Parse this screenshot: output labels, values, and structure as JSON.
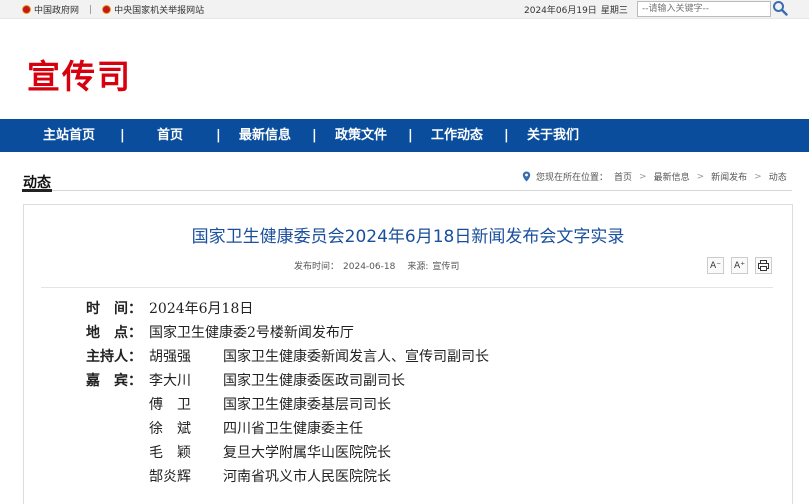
{
  "topbar": {
    "link1": "中国政府网",
    "separator": "|",
    "link2": "中央国家机关举报网站",
    "date": "2024年06月19日",
    "weekday": "星期三",
    "search_placeholder": "--请输入关键字--"
  },
  "header": {
    "site_title": "宣传司"
  },
  "nav": {
    "items": [
      "主站首页",
      "首页",
      "最新信息",
      "政策文件",
      "工作动态",
      "关于我们"
    ],
    "separator": "|"
  },
  "section": {
    "title": "动态"
  },
  "breadcrumb": {
    "prefix": "您现在所在位置：",
    "items": [
      "首页",
      "最新信息",
      "新闻发布",
      "动态"
    ],
    "arrow": ">"
  },
  "article": {
    "title": "国家卫生健康委员会2024年6月18日新闻发布会文字实录",
    "publish_label": "发布时间：",
    "publish_date": "2024-06-18",
    "source_label": "来源:",
    "source": "宣传司",
    "tools": {
      "font_smaller": "A⁻",
      "font_larger": "A⁺",
      "print_icon": "print-icon"
    },
    "time_label": "时　间：",
    "time_value": "2024年6月18日",
    "place_label": "地　点：",
    "place_value": "国家卫生健康委2号楼新闻发布厅",
    "host_label": "主持人：",
    "host_name": "胡强强",
    "host_role": "国家卫生健康委新闻发言人、宣传司副司长",
    "guests_label": "嘉　宾：",
    "guests": [
      {
        "name": "李大川",
        "role": "国家卫生健康委医政司副司长"
      },
      {
        "name": "傅　卫",
        "role": "国家卫生健康委基层司司长"
      },
      {
        "name": "徐　斌",
        "role": "四川省卫生健康委主任"
      },
      {
        "name": "毛　颖",
        "role": "复旦大学附属华山医院院长"
      },
      {
        "name": "郜炎辉",
        "role": "河南省巩义市人民医院院长"
      }
    ]
  }
}
